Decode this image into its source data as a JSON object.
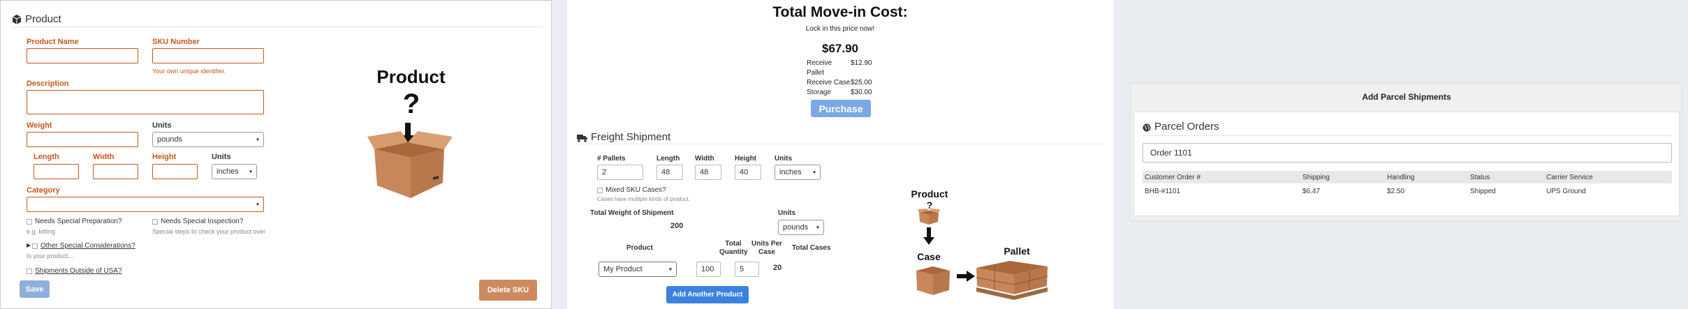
{
  "product_panel": {
    "title": "Product",
    "product_name_label": "Product Name",
    "sku_label": "SKU Number",
    "sku_help": "Your own unique identifier.",
    "description_label": "Description",
    "weight_label": "Weight",
    "units_label": "Units",
    "units_value": "pounds",
    "length_label": "Length",
    "width_label": "Width",
    "height_label": "Height",
    "dim_units_label": "Units",
    "dim_units_value": "inches",
    "category_label": "Category",
    "special_prep_label": "Needs Special Preparation?",
    "special_prep_help": "e.g. kitting",
    "special_inspection_label": "Needs Special Inspection?",
    "special_inspection_help": "Special steps to check your product over",
    "other_considerations_label": "Other Special Considerations?",
    "other_considerations_help": "Is your product...",
    "outside_usa_label": "Shipments Outside of USA?",
    "save_label": "Save",
    "delete_label": "Delete SKU",
    "illustration_title": "Product",
    "illustration_mark": "?"
  },
  "move_in": {
    "title": "Total Move-in Cost:",
    "subtitle": "Lock in this price now!",
    "total": "$67.90",
    "fees": [
      {
        "label": "Receive Pallet",
        "value": "$12.90"
      },
      {
        "label": "Receive Case",
        "value": "$25.00"
      },
      {
        "label": "Storage",
        "value": "$30.00"
      }
    ],
    "purchase_label": "Purchase"
  },
  "freight": {
    "title": "Freight Shipment",
    "pallets_label": "# Pallets",
    "pallets_value": "2",
    "length_label": "Length",
    "length_value": "48",
    "width_label": "Width",
    "width_value": "48",
    "height_label": "Height",
    "height_value": "40",
    "units_label": "Units",
    "units_value": "inches",
    "mixed_label": "Mixed SKU Cases?",
    "mixed_help": "Cases have multiple kinds of product.",
    "total_weight_label": "Total Weight of Shipment",
    "total_weight_value": "200",
    "weight_units_label": "Units",
    "weight_units_value": "pounds",
    "product_col": "Product",
    "total_qty_col": "Total Quantity",
    "units_per_case_col": "Units Per Case",
    "total_cases_col": "Total Cases",
    "product_value": "My Product",
    "qty_value": "100",
    "units_per_case_value": "5",
    "total_cases_value": "20",
    "add_product_label": "Add Another Product",
    "diagram_product": "Product",
    "diagram_mark": "?",
    "diagram_case": "Case",
    "diagram_pallet": "Pallet"
  },
  "parcel": {
    "header": "Add Parcel Shipments",
    "title": "Parcel Orders",
    "search_value": "Order 1101",
    "columns": [
      "Customer Order #",
      "Shipping",
      "Handling",
      "Status",
      "Carrier Service"
    ],
    "rows": [
      [
        "BHB-#1101",
        "$6.47",
        "$2.50",
        "Shipped",
        "UPS Ground"
      ]
    ]
  },
  "colors": {
    "accent": "#c4581d",
    "button_blue": "#3b82e0",
    "purchase_blue": "#7aa9e6",
    "save_blue": "#8fb0dc",
    "delete_orange": "#cd8a5e",
    "box": "#c8875a"
  }
}
